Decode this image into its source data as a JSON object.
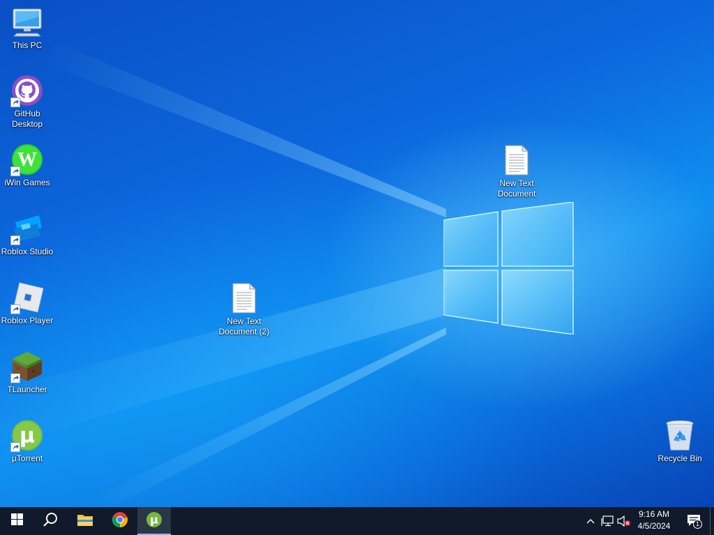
{
  "desktop": {
    "icons": [
      {
        "label": "This PC",
        "icon": "monitor-icon"
      },
      {
        "label": "GitHub\nDesktop",
        "icon": "github-desktop-icon",
        "shortcut": true
      },
      {
        "label": "iWin Games",
        "icon": "iwin-games-icon",
        "shortcut": true
      },
      {
        "label": "Roblox Studio",
        "icon": "roblox-studio-icon",
        "shortcut": true
      },
      {
        "label": "Roblox Player",
        "icon": "roblox-player-icon",
        "shortcut": true
      },
      {
        "label": "TLauncher",
        "icon": "tlauncher-icon",
        "shortcut": true
      },
      {
        "label": "µTorrent",
        "icon": "utorrent-icon",
        "shortcut": true
      },
      {
        "label": "New Text\nDocument (2)",
        "icon": "text-document-icon"
      },
      {
        "label": "New Text\nDocument",
        "icon": "text-document-icon"
      },
      {
        "label": "Recycle Bin",
        "icon": "recycle-bin-icon"
      }
    ]
  },
  "taskbar": {
    "start": "windows-start-icon",
    "search": "search-icon",
    "pinned": [
      {
        "name": "File Explorer",
        "icon": "folder-icon"
      },
      {
        "name": "Google Chrome",
        "icon": "chrome-icon"
      },
      {
        "name": "µTorrent",
        "icon": "utorrent-icon",
        "active": true
      }
    ],
    "tray": {
      "chevron": "chevron-up-icon",
      "network": "network-icon",
      "volume": "volume-muted-icon",
      "time": "9:16 AM",
      "date": "4/5/2024",
      "notifications_count": "1"
    }
  },
  "colors": {
    "wallpaper_accent": "#0c67dc",
    "taskbar_bg": "#101a2a",
    "utorrent_green": "#76b83f",
    "github_purple": "#8a4fc7"
  }
}
